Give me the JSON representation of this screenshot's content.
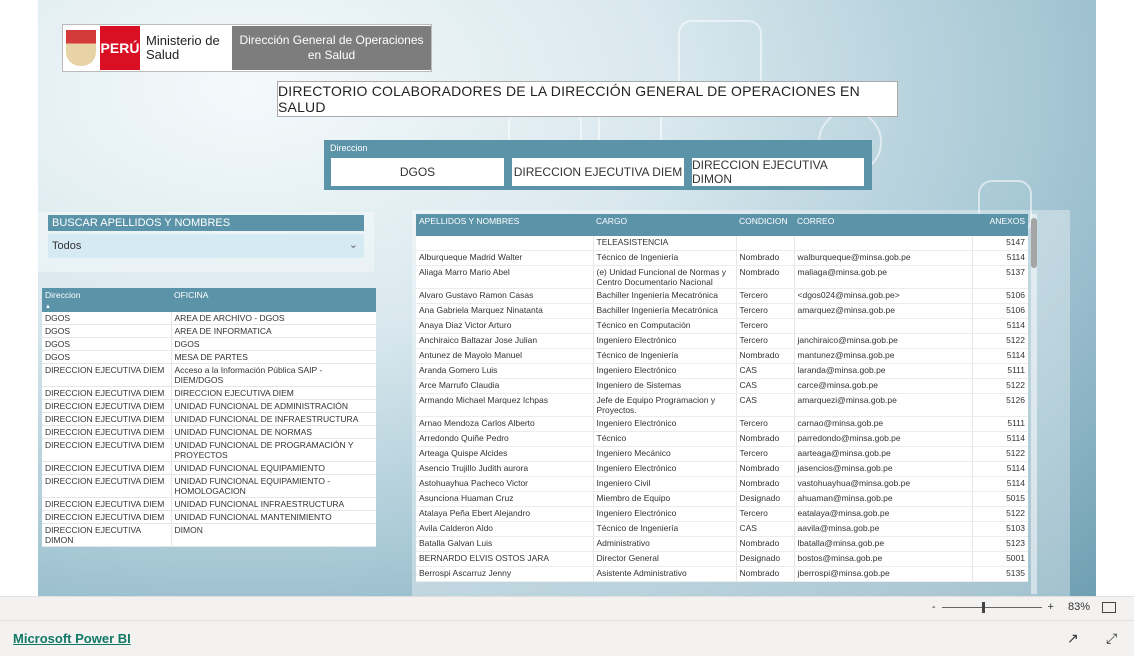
{
  "header": {
    "country": "PERÚ",
    "ministry": "Ministerio de Salud",
    "division": "Dirección General de Operaciones en Salud"
  },
  "title": "DIRECTORIO COLABORADORES DE LA DIRECCIÓN GENERAL DE OPERACIONES EN SALUD",
  "direccion_filter": {
    "label": "Direccion",
    "buttons": [
      "DGOS",
      "DIRECCION EJECUTIVA DIEM",
      "DIRECCION EJECUTIVA DIMON"
    ]
  },
  "search": {
    "label": "BUSCAR APELLIDOS Y NOMBRES",
    "value": "Todos"
  },
  "office_table": {
    "headers": [
      "Direccion",
      "OFICINA"
    ],
    "rows": [
      [
        "DGOS",
        "AREA DE ARCHIVO - DGOS"
      ],
      [
        "DGOS",
        "AREA DE INFORMATICA"
      ],
      [
        "DGOS",
        "DGOS"
      ],
      [
        "DGOS",
        "MESA DE PARTES"
      ],
      [
        "DIRECCION EJECUTIVA DIEM",
        "Acceso a la Información Pública SAIP - DIEM/DGOS"
      ],
      [
        "DIRECCION EJECUTIVA DIEM",
        "DIRECCION EJECUTIVA DIEM"
      ],
      [
        "DIRECCION EJECUTIVA DIEM",
        "UNIDAD FUNCIONAL DE ADMINISTRACIÓN"
      ],
      [
        "DIRECCION EJECUTIVA DIEM",
        "UNIDAD FUNCIONAL DE INFRAESTRUCTURA"
      ],
      [
        "DIRECCION EJECUTIVA DIEM",
        "UNIDAD FUNCIONAL DE NORMAS"
      ],
      [
        "DIRECCION EJECUTIVA DIEM",
        "UNIDAD FUNCIONAL DE PROGRAMACIÓN Y PROYECTOS"
      ],
      [
        "DIRECCION EJECUTIVA DIEM",
        "UNIDAD FUNCIONAL EQUIPAMIENTO"
      ],
      [
        "DIRECCION EJECUTIVA DIEM",
        "UNIDAD FUNCIONAL EQUIPAMIENTO - HOMOLOGACION"
      ],
      [
        "DIRECCION EJECUTIVA DIEM",
        "UNIDAD FUNCIONAL INFRAESTRUCTURA"
      ],
      [
        "DIRECCION EJECUTIVA DIEM",
        "UNIDAD FUNCIONAL MANTENIMIENTO"
      ],
      [
        "DIRECCION EJECUTIVA DIMON",
        "DIMON"
      ]
    ]
  },
  "people_table": {
    "headers": [
      "APELLIDOS Y NOMBRES",
      "CARGO",
      "CONDICION",
      "CORREO",
      "ANEXOS"
    ],
    "rows": [
      [
        "",
        "TELEASISTENCIA",
        "",
        "",
        "5147"
      ],
      [
        "Alburqueque Madrid Walter",
        "Técnico de Ingeniería",
        "Nombrado",
        "walburqueque@minsa.gob.pe",
        "5114"
      ],
      [
        "Aliaga Marro Mario Abel",
        "(e) Unidad Funcional de Normas y Centro Documentario Nacional",
        "Nombrado",
        "maliaga@minsa.gob.pe",
        "5137"
      ],
      [
        "Alvaro Gustavo Ramon Casas",
        "Bachiller Ingeniería Mecatrónica",
        "Tercero",
        "<dgos024@minsa.gob.pe>",
        "5106"
      ],
      [
        "Ana Gabriela Marquez Ninatanta",
        "Bachiller Ingeniería Mecatrónica",
        "Tercero",
        "amarquez@minsa.gob.pe",
        "5106"
      ],
      [
        "Anaya Diaz Victor Arturo",
        "Técnico en Computación",
        "Tercero",
        "",
        "5114"
      ],
      [
        "Anchiraico Baltazar Jose Julian",
        "Ingeniero Electrónico",
        "Tercero",
        "janchiraico@minsa.gob.pe",
        "5122"
      ],
      [
        "Antunez de Mayolo Manuel",
        "Técnico de Ingeniería",
        "Nombrado",
        "mantunez@minsa.gob.pe",
        "5114"
      ],
      [
        "Aranda Gomero Luis",
        "Ingeniero Electrónico",
        "CAS",
        "laranda@minsa.gob.pe",
        "5111"
      ],
      [
        "Arce Marrufo Claudia",
        "Ingeniero de Sistemas",
        "CAS",
        "carce@minsa.gob.pe",
        "5122"
      ],
      [
        "Armando Michael Marquez Ichpas",
        "Jefe de Equipo Programacion y Proyectos.",
        "CAS",
        "amarquezi@minsa.gob.pe",
        "5126"
      ],
      [
        "Arnao Mendoza Carlos Alberto",
        "Ingeniero Electrónico",
        "Tercero",
        "carnao@minsa.gob.pe",
        "5111"
      ],
      [
        "Arredondo Quiñe Pedro",
        "Técnico",
        "Nombrado",
        "parredondo@minsa.gob.pe",
        "5114"
      ],
      [
        "Arteaga Quispe Alcides",
        "Ingeniero Mecánico",
        "Tercero",
        "aarteaga@minsa.gob.pe",
        "5122"
      ],
      [
        "Asencio Trujillo Judith aurora",
        "Ingeniero Electrónico",
        "Nombrado",
        "jasencios@minsa.gob.pe",
        "5114"
      ],
      [
        "Astohuayhua Pacheco Victor",
        "Ingeniero Civil",
        "Nombrado",
        "vastohuayhua@minsa.gob.pe",
        "5114"
      ],
      [
        "Asunciona Huaman Cruz",
        "Miembro de Equipo",
        "Designado",
        "ahuaman@minsa.gob.pe",
        "5015"
      ],
      [
        "Atalaya Peña Ebert Alejandro",
        "Ingeniero Electrónico",
        "Tercero",
        "eatalaya@minsa.gob.pe",
        "5122"
      ],
      [
        "Avila Calderon Aldo",
        "Técnico de Ingeniería",
        "CAS",
        "aavila@minsa.gob.pe",
        "5103"
      ],
      [
        "Batalla Galvan Luis",
        "Administrativo",
        "Nombrado",
        "lbatalla@minsa.gob.pe",
        "5123"
      ],
      [
        "BERNARDO ELVIS OSTOS JARA",
        "Director General",
        "Designado",
        "bostos@minsa.gob.pe",
        "5001"
      ],
      [
        "Berrospi Ascarruz Jenny",
        "Asistente Administrativo",
        "Nombrado",
        "jberrospi@minsa.gob.pe",
        "5135"
      ]
    ]
  },
  "status": {
    "zoom": "83%",
    "minus": "-",
    "plus": "+"
  },
  "footer": {
    "link": "Microsoft Power BI"
  }
}
